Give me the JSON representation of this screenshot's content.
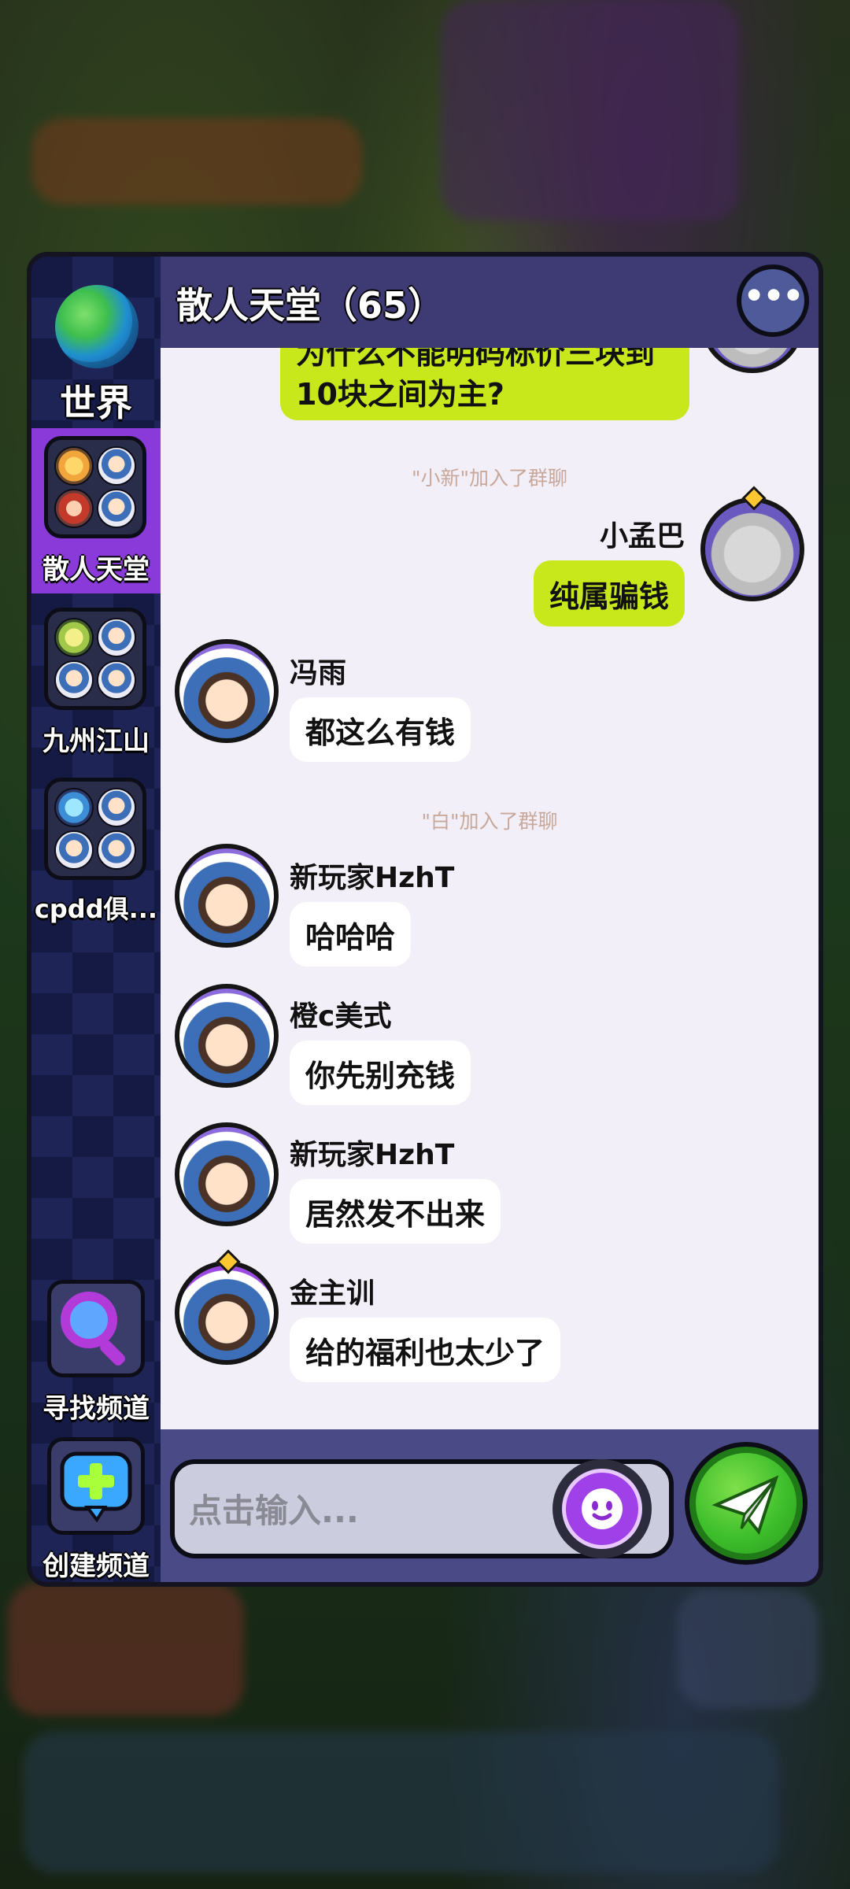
{
  "window": {
    "title": "散人天堂（65）"
  },
  "sidebar": {
    "world_label": "世界",
    "channels": [
      {
        "label": "散人天堂",
        "active": true
      },
      {
        "label": "九州江山",
        "active": false
      },
      {
        "label": "cpdd俱...",
        "active": false
      }
    ],
    "find_channel_label": "寻找频道",
    "create_channel_label": "创建频道"
  },
  "chat": {
    "messages": [
      {
        "type": "mine",
        "text_line1": "为什么不能明码标价三块到",
        "text_line2": "10块之间为主?"
      },
      {
        "type": "system",
        "text": "\"小新\"加入了群聊"
      },
      {
        "type": "mine",
        "name": "小孟巴",
        "text": "纯属骗钱"
      },
      {
        "type": "other",
        "name": "冯雨",
        "text": "都这么有钱"
      },
      {
        "type": "system",
        "text": "\"白\"加入了群聊"
      },
      {
        "type": "other",
        "name": "新玩家HzhT",
        "text": "哈哈哈"
      },
      {
        "type": "other",
        "name": "橙c美式",
        "text": "你先别充钱"
      },
      {
        "type": "other",
        "name": "新玩家HzhT",
        "text": "居然发不出来"
      },
      {
        "type": "other",
        "name": "金主训",
        "text": "给的福利也太少了"
      }
    ]
  },
  "input": {
    "placeholder": "点击输入..."
  },
  "colors": {
    "mine_bubble": "#c8e81c",
    "active_tab": "#8a3ad8",
    "send_button": "#3fbf2c"
  }
}
